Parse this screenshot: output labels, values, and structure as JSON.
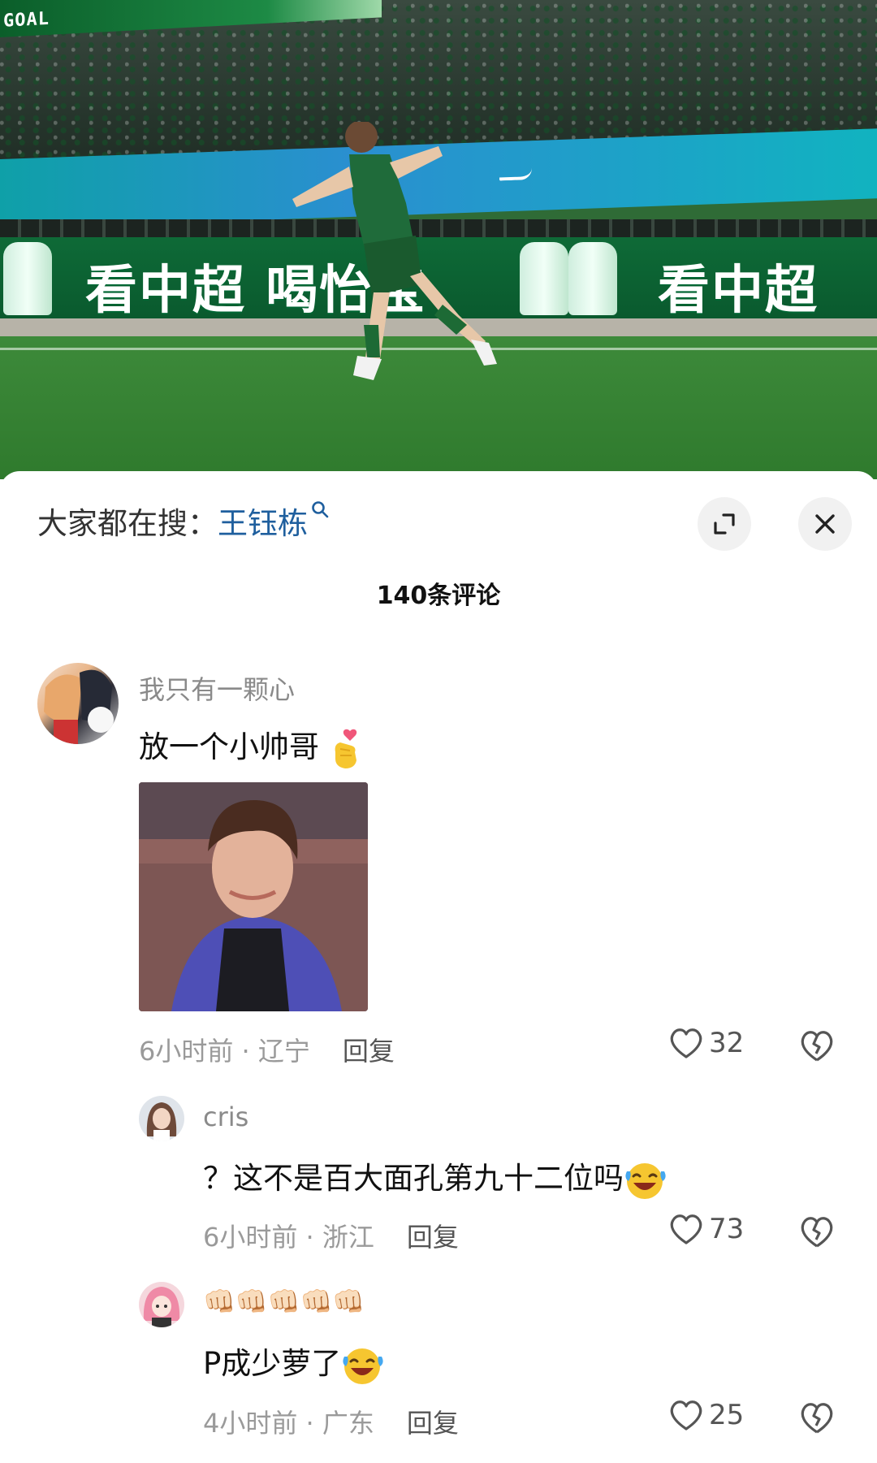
{
  "video": {
    "score_label": "GOAL",
    "ad_left": "看中超 喝怡宝",
    "ad_right": "看中超"
  },
  "sheet": {
    "search_prefix": "大家都在搜：",
    "search_keyword": "王钰栋",
    "comment_count": "140条评论"
  },
  "comments": [
    {
      "user": "我只有一颗心",
      "text": "放一个小帅哥",
      "time": "6小时前 · 辽宁",
      "reply": "回复",
      "likes": "32",
      "emoji": "finger-heart-emoji"
    },
    {
      "user": "cris",
      "text": "？这不是百大面孔第九十二位吗",
      "time": "6小时前 · 浙江",
      "reply": "回复",
      "likes": "73",
      "emoji": "laughing-crying-emoji"
    },
    {
      "user": "👊🏻👊🏻👊🏻👊🏻👊🏻",
      "text": "P成少萝了",
      "time": "4小时前 · 广东",
      "reply": "回复",
      "likes": "25",
      "emoji": "laughing-crying-emoji"
    }
  ],
  "colors": {
    "keyword_blue": "#1f5f9e",
    "pitch_green": "#2f7a2d",
    "brand_green": "#0b5e2a"
  }
}
